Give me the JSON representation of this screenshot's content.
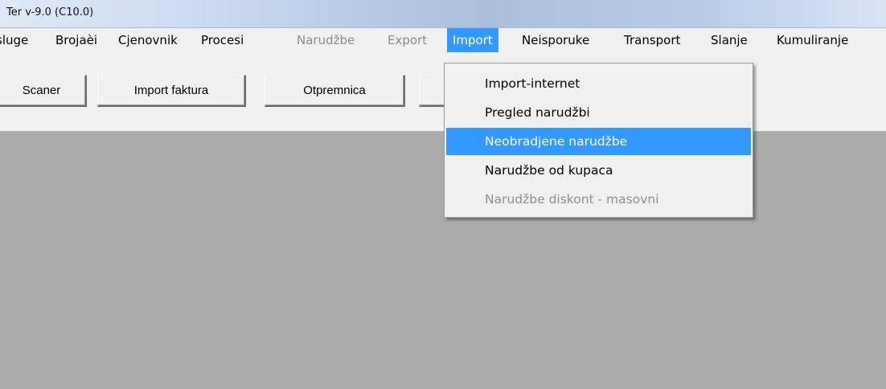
{
  "window": {
    "title": "Ter v-9.0  (C10.0)"
  },
  "menubar": {
    "items": [
      {
        "label": "sluge",
        "state": "normal"
      },
      {
        "label": "Brojaèi",
        "state": "normal"
      },
      {
        "label": "Cjenovnik",
        "state": "normal"
      },
      {
        "label": "Procesi",
        "state": "normal"
      },
      {
        "label": "Narudžbe",
        "state": "disabled"
      },
      {
        "label": "Export",
        "state": "disabled"
      },
      {
        "label": "Import",
        "state": "active"
      },
      {
        "label": "Neisporuke",
        "state": "normal"
      },
      {
        "label": "Transport",
        "state": "normal"
      },
      {
        "label": "Slanje",
        "state": "normal"
      },
      {
        "label": "Kumuliranje",
        "state": "normal"
      }
    ]
  },
  "toolbar": {
    "buttons": [
      {
        "label": "Scaner"
      },
      {
        "label": "Import faktura"
      },
      {
        "label": "Otpremnica"
      },
      {
        "label": ""
      }
    ]
  },
  "import_menu": {
    "items": [
      {
        "label": "Import-internet",
        "state": "normal"
      },
      {
        "label": "Pregled narudžbi",
        "state": "normal"
      },
      {
        "label": "Neobradjene narudžbe",
        "state": "highlighted"
      },
      {
        "label": "Narudžbe od kupaca",
        "state": "normal"
      },
      {
        "label": "Narudžbe diskont - masovni",
        "state": "disabled"
      }
    ]
  },
  "colors": {
    "highlight": "#3399ff",
    "workspace": "#ababab",
    "disabled_text": "#8a8a8a"
  }
}
